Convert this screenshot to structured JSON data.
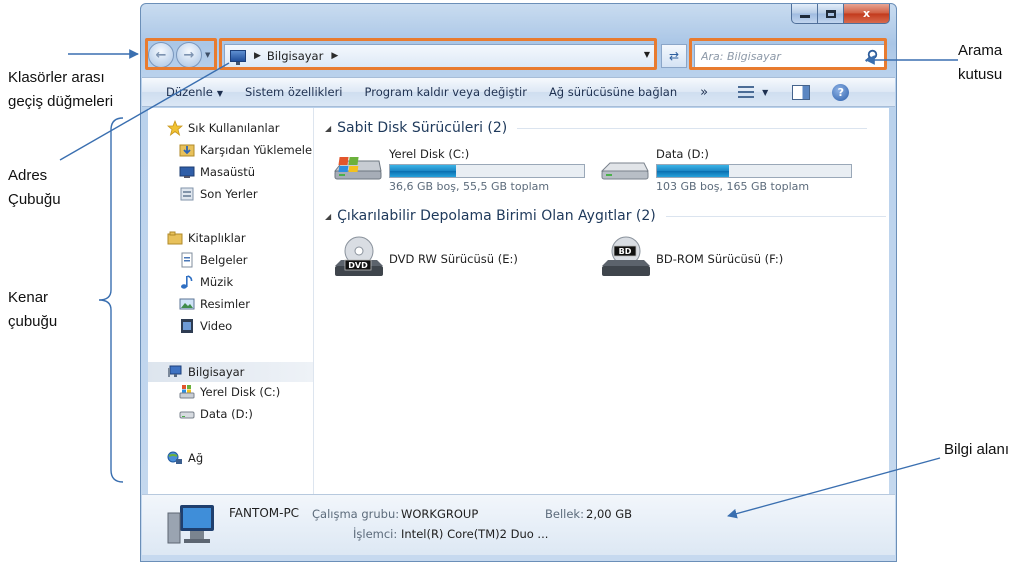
{
  "window": {
    "caption_buttons": {
      "minimize": "minimize",
      "maximize": "maximize",
      "close": "x"
    }
  },
  "nav": {
    "back_icon": "back-arrow-icon",
    "forward_icon": "forward-arrow-icon"
  },
  "address": {
    "location": "Bilgisayar"
  },
  "search": {
    "placeholder": "Ara: Bilgisayar"
  },
  "toolbar": {
    "organize": "Düzenle",
    "system_properties": "Sistem özellikleri",
    "uninstall": "Program kaldır veya değiştir",
    "map_drive": "Ağ sürücüsüne bağlan",
    "more": "»"
  },
  "sidebar": {
    "favorites": {
      "title": "Sık Kullanılanlar",
      "items": [
        "Karşıdan Yüklemeler",
        "Masaüstü",
        "Son Yerler"
      ]
    },
    "libraries": {
      "title": "Kitaplıklar",
      "items": [
        "Belgeler",
        "Müzik",
        "Resimler",
        "Video"
      ]
    },
    "computer": {
      "title": "Bilgisayar",
      "items": [
        "Yerel Disk (C:)",
        "Data (D:)"
      ]
    },
    "network": {
      "title": "Ağ"
    }
  },
  "content": {
    "hard_disks": {
      "header": "Sabit Disk Sürücüleri (2)",
      "drives": [
        {
          "name": "Yerel Disk (C:)",
          "free": "36,6 GB boş, 55,5 GB toplam",
          "used_fraction": 0.34
        },
        {
          "name": "Data (D:)",
          "free": "103 GB boş, 165 GB toplam",
          "used_fraction": 0.37
        }
      ]
    },
    "removable": {
      "header": "Çıkarılabilir Depolama Birimi Olan Aygıtlar (2)",
      "drives": [
        {
          "name": "DVD RW Sürücüsü (E:)",
          "badge": "DVD"
        },
        {
          "name": "BD-ROM Sürücüsü (F:)",
          "badge": "BD"
        }
      ]
    }
  },
  "details": {
    "computer_name": "FANTOM-PC",
    "workgroup_label": "Çalışma grubu:",
    "workgroup_value": "WORKGROUP",
    "memory_label": "Bellek:",
    "memory_value": "2,00 GB",
    "processor_label": "İşlemci:",
    "processor_value": "Intel(R) Core(TM)2 Duo ..."
  },
  "annotations": {
    "nav_buttons": [
      "Klasörler arası",
      "geçiş düğmeleri"
    ],
    "address_bar": [
      "Adres",
      "Çubuğu"
    ],
    "sidebar": [
      "Kenar",
      "çubuğu"
    ],
    "search_box": [
      "Arama",
      "kutusu"
    ],
    "details_pane": "Bilgi alanı"
  },
  "colors": {
    "highlight": "#e87b2f",
    "annotation_line": "#3a6fb0",
    "progress_fill": "#1b86c5"
  }
}
